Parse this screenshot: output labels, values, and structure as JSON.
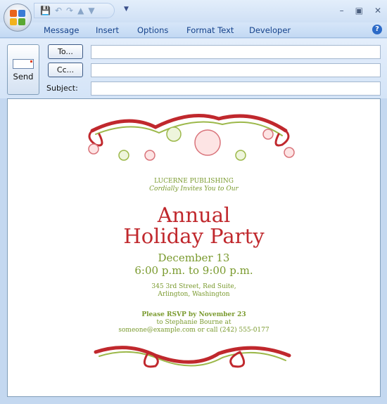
{
  "ribbon": {
    "tabs": [
      "Message",
      "Insert",
      "Options",
      "Format Text",
      "Developer"
    ]
  },
  "compose": {
    "send_label": "Send",
    "to_label": "To...",
    "cc_label": "Cc...",
    "subject_label": "Subject:",
    "to_value": "",
    "cc_value": "",
    "subject_value": ""
  },
  "invitation": {
    "company": "LUCERNE PUBLISHING",
    "tagline": "Cordially Invites You to Our",
    "title_line1": "Annual",
    "title_line2": "Holiday Party",
    "date": "December 13",
    "time": "6:00 p.m. to 9:00 p.m.",
    "address_line1": "345 3rd Street, Red Suite,",
    "address_line2": "Arlington, Washington",
    "rsvp": "Please RSVP by November 23",
    "rsvp_to": "to  Stephanie Bourne at",
    "contact": "someone@example.com or call (242) 555-0177"
  },
  "colors": {
    "red": "#c0282d",
    "green": "#7a9a2e",
    "accent": "#15428b"
  }
}
